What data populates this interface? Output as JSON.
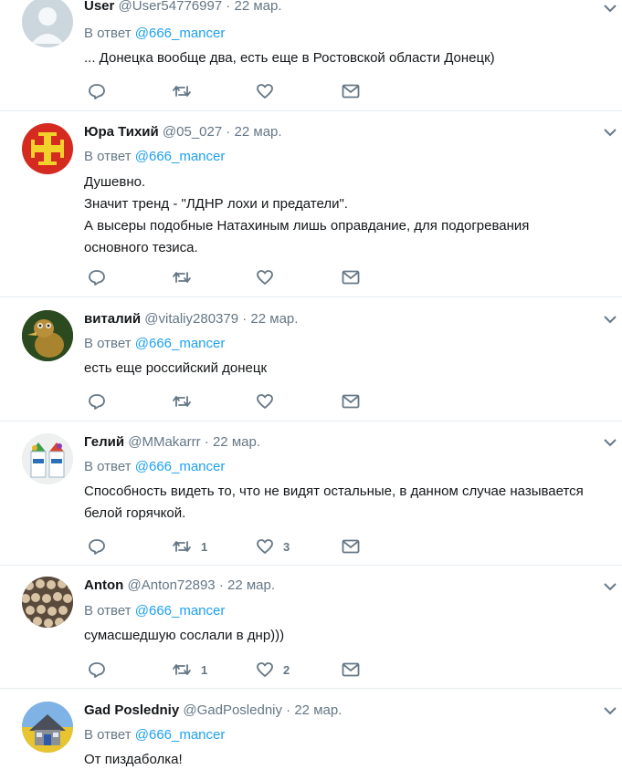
{
  "reply_prefix": "В ответ",
  "colors": {
    "accent": "#1da1f2",
    "muted": "#657786",
    "text": "#14171a",
    "divider": "#e6ecf0"
  },
  "icons": {
    "reply": "reply-icon",
    "retweet": "retweet-icon",
    "like": "heart-icon",
    "dm": "envelope-icon",
    "menu": "chevron-down-icon"
  },
  "tweets": [
    {
      "name": "User",
      "handle": "@User54776997",
      "sep": "·",
      "time": "22 мар.",
      "reply_to": "@666_mancer",
      "lines": [
        "... Донецка вообще два, есть еще в Ростовской области Донецк)"
      ],
      "retweets": "",
      "likes": "",
      "avatar": "default-avatar"
    },
    {
      "name": "Юра Тихий",
      "handle": "@05_027",
      "sep": "·",
      "time": "22 мар.",
      "reply_to": "@666_mancer",
      "lines": [
        "Душевно.",
        "Значит тренд - \"ЛДНР лохи и предатели\".",
        "А высеры подобные Натахиным лишь оправдание, для подогревания",
        "основного тезиса."
      ],
      "retweets": "",
      "likes": "",
      "avatar": "cross-emblem-avatar"
    },
    {
      "name": "виталий",
      "handle": "@vitaliy280379",
      "sep": "·",
      "time": "22 мар.",
      "reply_to": "@666_mancer",
      "lines": [
        "есть еще российский донецк"
      ],
      "retweets": "",
      "likes": "",
      "avatar": "bird-photo-avatar"
    },
    {
      "name": "Гелий",
      "handle": "@MMakarrr",
      "sep": "·",
      "time": "22 мар.",
      "reply_to": "@666_mancer",
      "lines": [
        "Способность видеть то, что не видят остальные, в данном случае называется",
        "белой горячкой."
      ],
      "retweets": "1",
      "likes": "3",
      "avatar": "milk-carton-avatar"
    },
    {
      "name": "Anton",
      "handle": "@Anton72893",
      "sep": "·",
      "time": "22 мар.",
      "reply_to": "@666_mancer",
      "lines": [
        "сумасшедшую сослали в днр)))"
      ],
      "retweets": "1",
      "likes": "2",
      "avatar": "crowd-photo-avatar"
    },
    {
      "name": "Gad Posledniy",
      "handle": "@GadPosledniy",
      "sep": "·",
      "time": "22 мар.",
      "reply_to": "@666_mancer",
      "lines": [
        "От пиздаболка!"
      ],
      "retweets": "",
      "likes": "",
      "avatar": "house-flag-avatar"
    }
  ]
}
